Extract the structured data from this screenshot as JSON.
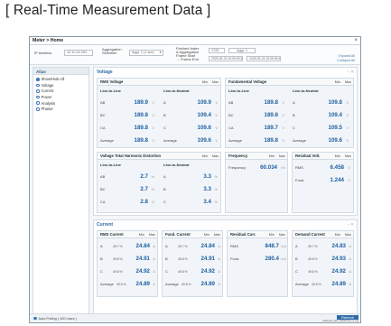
{
  "page_heading": "[ Real-Time Measurement Data ]",
  "window": {
    "title": "Meter > Home",
    "close": "×"
  },
  "toolbar": {
    "ip_label": "IP Address",
    "ip_value": "10.10.20.251",
    "aggregation_label": "Aggregation Selection",
    "aggregation_value": "Aggr. 1 (1 sec)",
    "fetched_index_label": "Fetched Index",
    "aggregation_frame_label": "& Aggregation",
    "frame_start_label": "Frame Start",
    "frame_end_label": "→ Frame End",
    "fetched_index_value": "1725",
    "aggregation_frame_value": "Aggr. 1",
    "frame_start_value": "2025-06-23 15:09:05.422",
    "frame_end_value": "2025-06-23 15:09:06.421",
    "expand_all": "Expand All",
    "collapse_all": "Collapse All"
  },
  "alias": {
    "header": "Alias",
    "items": [
      {
        "label": "Show/Hide All",
        "selected": true
      },
      {
        "label": "Voltage",
        "selected": false
      },
      {
        "label": "Current",
        "selected": false
      },
      {
        "label": "Power",
        "selected": false
      },
      {
        "label": "Analysis",
        "selected": false
      },
      {
        "label": "Phasor",
        "selected": false
      }
    ]
  },
  "voltage": {
    "title": "Voltage",
    "controls": "− ✕",
    "rms": {
      "title": "RMS Voltage",
      "min": "Min",
      "max": "Max",
      "ll_label": "Line-to-Line",
      "ln_label": "Line-to-Neutral",
      "ll": [
        {
          "label": "AB",
          "value": "189.9",
          "unit": "V"
        },
        {
          "label": "BC",
          "value": "189.8",
          "unit": "V"
        },
        {
          "label": "CA",
          "value": "189.8",
          "unit": "V"
        },
        {
          "label": "Average",
          "value": "189.8",
          "unit": "V"
        }
      ],
      "ln": [
        {
          "label": "A",
          "value": "109.9",
          "unit": "V"
        },
        {
          "label": "B",
          "value": "109.4",
          "unit": "V"
        },
        {
          "label": "C",
          "value": "109.6",
          "unit": "V"
        },
        {
          "label": "Average",
          "value": "109.6",
          "unit": "V"
        }
      ]
    },
    "fundamental": {
      "title": "Fundamental Voltage",
      "min": "Min",
      "max": "Max",
      "ll_label": "Line-to-Line",
      "ln_label": "Line-to-Neutral",
      "ll": [
        {
          "label": "AB",
          "value": "189.8",
          "unit": "V"
        },
        {
          "label": "BC",
          "value": "189.8",
          "unit": "V"
        },
        {
          "label": "CA",
          "value": "189.7",
          "unit": "V"
        },
        {
          "label": "Average",
          "value": "189.8",
          "unit": "V"
        }
      ],
      "ln": [
        {
          "label": "A",
          "value": "109.8",
          "unit": "V"
        },
        {
          "label": "B",
          "value": "109.4",
          "unit": "V"
        },
        {
          "label": "C",
          "value": "109.5",
          "unit": "V"
        },
        {
          "label": "Average",
          "value": "109.6",
          "unit": "V"
        }
      ]
    },
    "thd": {
      "title": "Voltage Total Harmonic Distortion",
      "min": "Min",
      "max": "Max",
      "ll_label": "Line-to-Line",
      "ln_label": "Line-to-Neutral",
      "ll": [
        {
          "label": "AB",
          "value": "2.7",
          "unit": "%"
        },
        {
          "label": "BC",
          "value": "2.7",
          "unit": "%"
        },
        {
          "label": "CA",
          "value": "2.8",
          "unit": "%"
        }
      ],
      "ln": [
        {
          "label": "A",
          "value": "3.3",
          "unit": "%"
        },
        {
          "label": "B",
          "value": "3.3",
          "unit": "%"
        },
        {
          "label": "C",
          "value": "3.4",
          "unit": "%"
        }
      ]
    },
    "frequency": {
      "title": "Frequency",
      "min": "Min",
      "max": "Max",
      "label": "Frequency",
      "value": "60.034",
      "unit": "Hz"
    },
    "residual": {
      "title": "Residual Volt.",
      "min": "Min",
      "max": "Max",
      "rows": [
        {
          "label": "RMS",
          "value": "6.458",
          "unit": "V"
        },
        {
          "label": "Fund.",
          "value": "1.244",
          "unit": "V"
        }
      ]
    }
  },
  "current": {
    "title": "Current",
    "controls": "− ✕",
    "rms": {
      "title": "RMS Current",
      "min": "Min",
      "max": "Max",
      "rows": [
        {
          "label": "A",
          "pct": "49.7 %",
          "value": "24.84",
          "unit": "A"
        },
        {
          "label": "B",
          "pct": "49.8 %",
          "value": "24.91",
          "unit": "A"
        },
        {
          "label": "C",
          "pct": "49.8 %",
          "value": "24.92",
          "unit": "A"
        },
        {
          "label": "Average",
          "pct": "49.8 %",
          "value": "24.89",
          "unit": "A"
        }
      ]
    },
    "fund": {
      "title": "Fund. Current",
      "min": "Min",
      "max": "Max",
      "rows": [
        {
          "label": "A",
          "pct": "49.7 %",
          "value": "24.84",
          "unit": "A"
        },
        {
          "label": "B",
          "pct": "49.8 %",
          "value": "24.91",
          "unit": "A"
        },
        {
          "label": "C",
          "pct": "49.8 %",
          "value": "24.92",
          "unit": "A"
        },
        {
          "label": "Average",
          "pct": "49.8 %",
          "value": "24.89",
          "unit": "A"
        }
      ]
    },
    "residual": {
      "title": "Residual Curr.",
      "min": "Min",
      "max": "Max",
      "rows": [
        {
          "label": "RMS",
          "value": "848.7",
          "unit": "mA"
        },
        {
          "label": "Fund.",
          "value": "280.4",
          "unit": "mA"
        }
      ]
    },
    "demand": {
      "title": "Demand Current",
      "min": "Min",
      "max": "Max",
      "rows": [
        {
          "label": "A",
          "pct": "49.7 %",
          "value": "24.83",
          "unit": "A"
        },
        {
          "label": "B",
          "pct": "49.8 %",
          "value": "24.93",
          "unit": "A"
        },
        {
          "label": "C",
          "pct": "49.8 %",
          "value": "24.92",
          "unit": "A"
        },
        {
          "label": "Average",
          "pct": "49.8 %",
          "value": "24.89",
          "unit": "A"
        }
      ]
    }
  },
  "statusbar": {
    "auto_polling": "Auto Polling ( 100 msec )",
    "refresh": "Refresh",
    "info": "Refresh | #0 | 15:09:10 | 4 ms"
  },
  "colors": {
    "accent": "#2f6aa7",
    "value": "#1f5fa0",
    "panel": "#f1f5f9"
  }
}
